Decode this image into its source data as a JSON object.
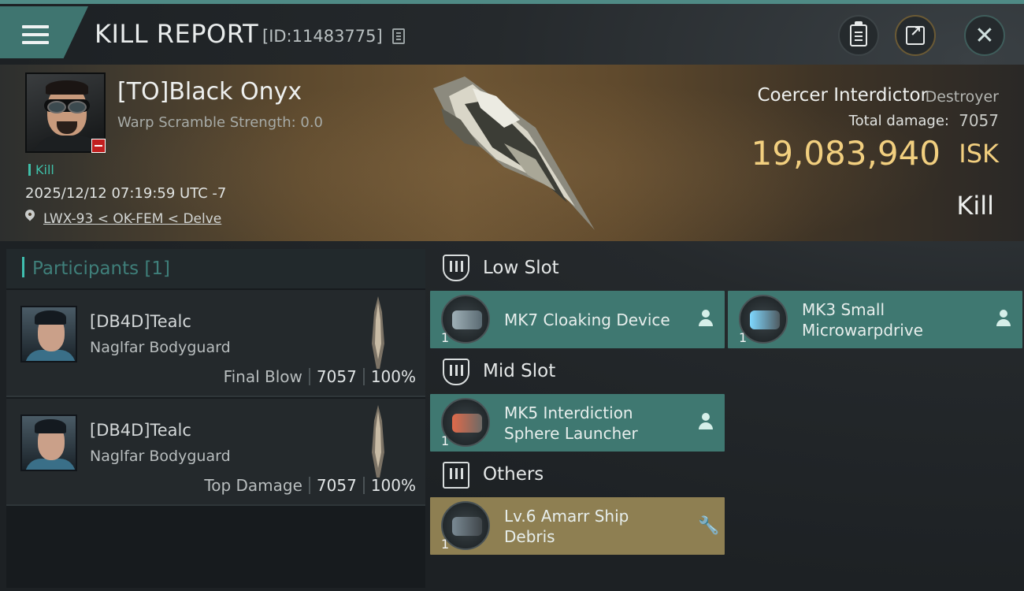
{
  "header": {
    "title": "KILL REPORT",
    "report_id": "[ID:11483775]",
    "icons": {
      "menu": "hamburger-icon",
      "copy": "copy-icon",
      "clipboard": "clipboard-icon",
      "share": "share-icon",
      "close": "close-icon"
    }
  },
  "victim": {
    "name": "[TO]Black Onyx",
    "warp_scramble": "Warp Scramble Strength: 0.0",
    "tag": "Kill",
    "datetime": "2025/12/12 07:19:59 UTC -7",
    "location": "LWX-93 < OK-FEM < Delve",
    "ship_name": "Coercer Interdictor",
    "ship_class": "Destroyer",
    "total_damage_label": "Total damage:",
    "total_damage_value": "7057",
    "isk_value": "19,083,940",
    "isk_unit": "ISK",
    "outcome": "Kill"
  },
  "participants": {
    "title": "Participants [1]",
    "rows": [
      {
        "name": "[DB4D]Tealc",
        "ship": "Naglfar Bodyguard",
        "role": "Final Blow",
        "damage": "7057",
        "percent": "100%"
      },
      {
        "name": "[DB4D]Tealc",
        "ship": "Naglfar Bodyguard",
        "role": "Top Damage",
        "damage": "7057",
        "percent": "100%"
      }
    ]
  },
  "slots": {
    "low": {
      "label": "Low Slot",
      "items": [
        {
          "name": "MK7 Cloaking Device",
          "qty": "1",
          "icon": "person-icon"
        },
        {
          "name_line1": "MK3 Small",
          "name_line2": "Microwarpdrive",
          "qty": "1",
          "icon": "person-icon"
        }
      ]
    },
    "mid": {
      "label": "Mid Slot",
      "items": [
        {
          "name_line1": "MK5 Interdiction",
          "name_line2": "Sphere Launcher",
          "qty": "1",
          "icon": "person-icon"
        }
      ]
    },
    "others": {
      "label": "Others",
      "items": [
        {
          "name_line1": "Lv.6 Amarr Ship",
          "name_line2": "Debris",
          "qty": "1",
          "icon": "wrench-icon"
        }
      ]
    }
  },
  "colors": {
    "accent_teal": "#3f7871",
    "accent_gold": "#8e7f52",
    "isk_gold": "#f2cf7f",
    "kill_green": "#3fbfa9",
    "victim_badge_red": "#c11f1f"
  }
}
